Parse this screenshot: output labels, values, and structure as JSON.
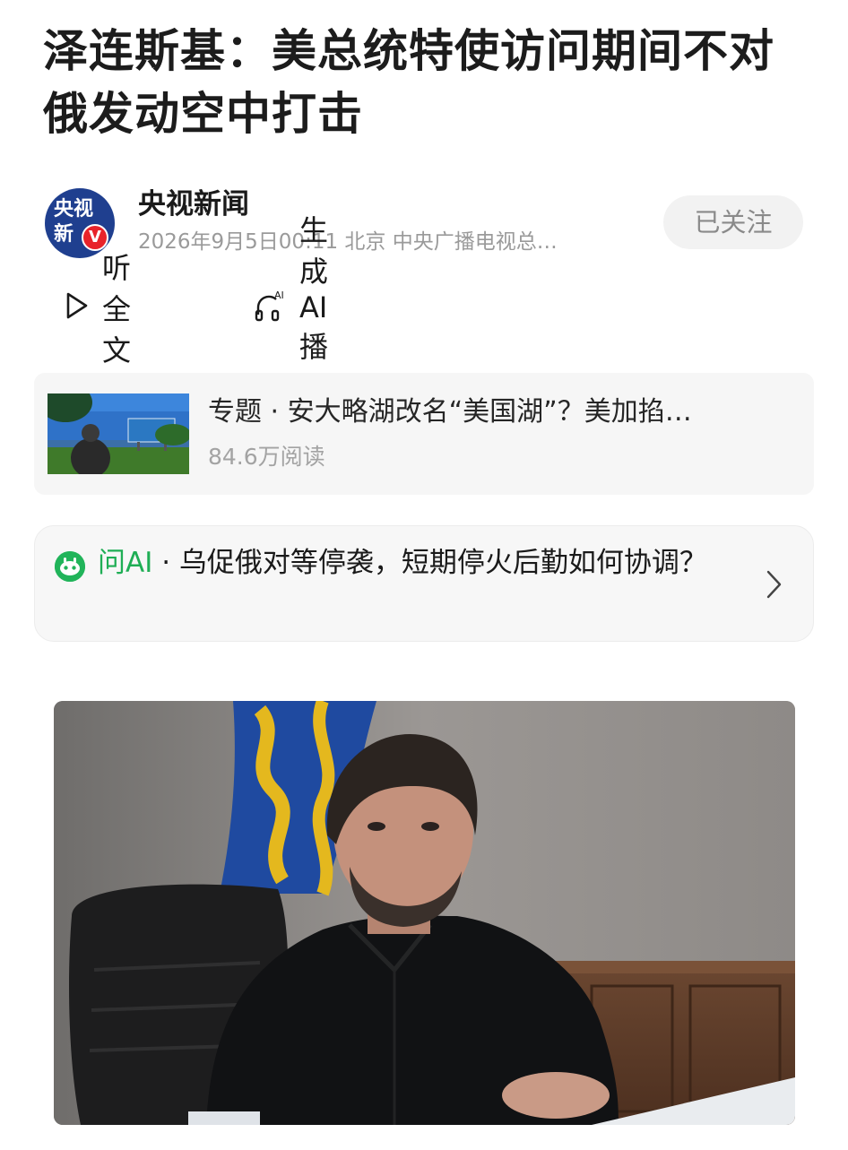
{
  "article": {
    "title": "泽连斯基：美总统特使访问期间不对俄发动空中打击"
  },
  "author": {
    "avatar_text_1": "央视",
    "avatar_text_2": "新",
    "avatar_badge": "V",
    "name": "央视新闻",
    "meta": "2026年9月5日00:11 北京 中央广播电视总…",
    "follow_label": "已关注"
  },
  "actions": {
    "listen_label": "听全文",
    "podcast_label": "生成AI播客",
    "podcast_icon_badge": "AI"
  },
  "topic": {
    "title": "专题 · 安大略湖改名“美国湖”？美加掐…",
    "reads": "84.6万阅读"
  },
  "ask_ai": {
    "brand": "问AI",
    "separator": " · ",
    "question": "乌促俄对等停袭，短期停火后勤如何协调？"
  },
  "icons": {
    "play": "play-outline-icon",
    "podcast": "headphones-ai-icon",
    "ai": "ai-assistant-icon",
    "chevron": "chevron-right-icon"
  },
  "colors": {
    "accent_green": "#1fae55",
    "badge_red": "#e8232a",
    "avatar_blue": "#1f3f8f",
    "muted_text": "#9a9a9a"
  }
}
